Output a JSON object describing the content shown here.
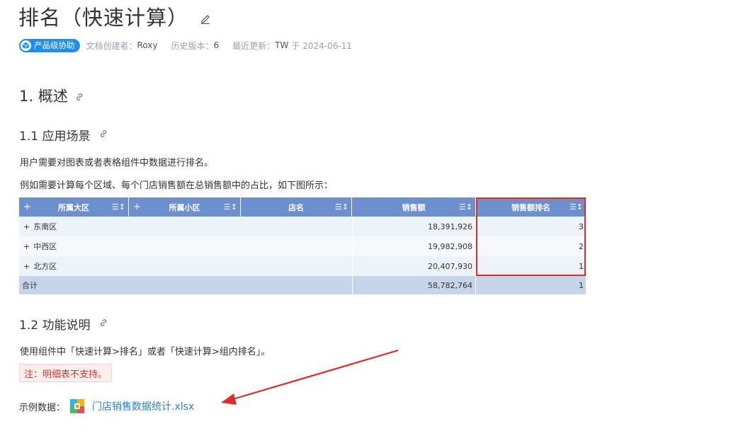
{
  "title": "排名（快速计算）",
  "meta": {
    "badge": "产品级协助",
    "creator_label": "文档创建者：",
    "creator": "Roxy",
    "version_label": "历史版本：",
    "version": "6",
    "updated_label": "最近更新：",
    "updated_by": "TW",
    "updated_on": "于 2024-06-11"
  },
  "sections": {
    "s1": "1. 概述",
    "s11": "1.1 应用场景",
    "s11_p1": "用户需要对图表或者表格组件中数据进行排名。",
    "s11_p2": "例如需要计算每个区域、每个门店销售额在总销售额中的占比，如下图所示：",
    "s12": "1.2 功能说明",
    "s12_p1": "使用组件中「快速计算>排名」或者「快速计算>组内排名」。",
    "note": "注：明细表不支持。",
    "sample_label": "示例数据：",
    "sample_file": "门店销售数据统计.xlsx"
  },
  "table": {
    "headers": {
      "region": "所属大区",
      "subregion": "所属小区",
      "store": "店名",
      "sales": "销售额",
      "rank": "销售额排名"
    },
    "rows": [
      {
        "region": "东南区",
        "sales": "18,391,926",
        "rank": "3"
      },
      {
        "region": "中西区",
        "sales": "19,982,908",
        "rank": "2"
      },
      {
        "region": "北方区",
        "sales": "20,407,930",
        "rank": "1"
      }
    ],
    "total": {
      "label": "合计",
      "sales": "58,782,764",
      "rank": "1"
    },
    "plus": "+",
    "sort": "☰↕"
  },
  "colors": {
    "accent": "#1e8ef0",
    "table_header": "#6d8fcf",
    "highlight_box": "#d92b2b",
    "link": "#2f7fcf",
    "note_text": "#e0332f"
  }
}
